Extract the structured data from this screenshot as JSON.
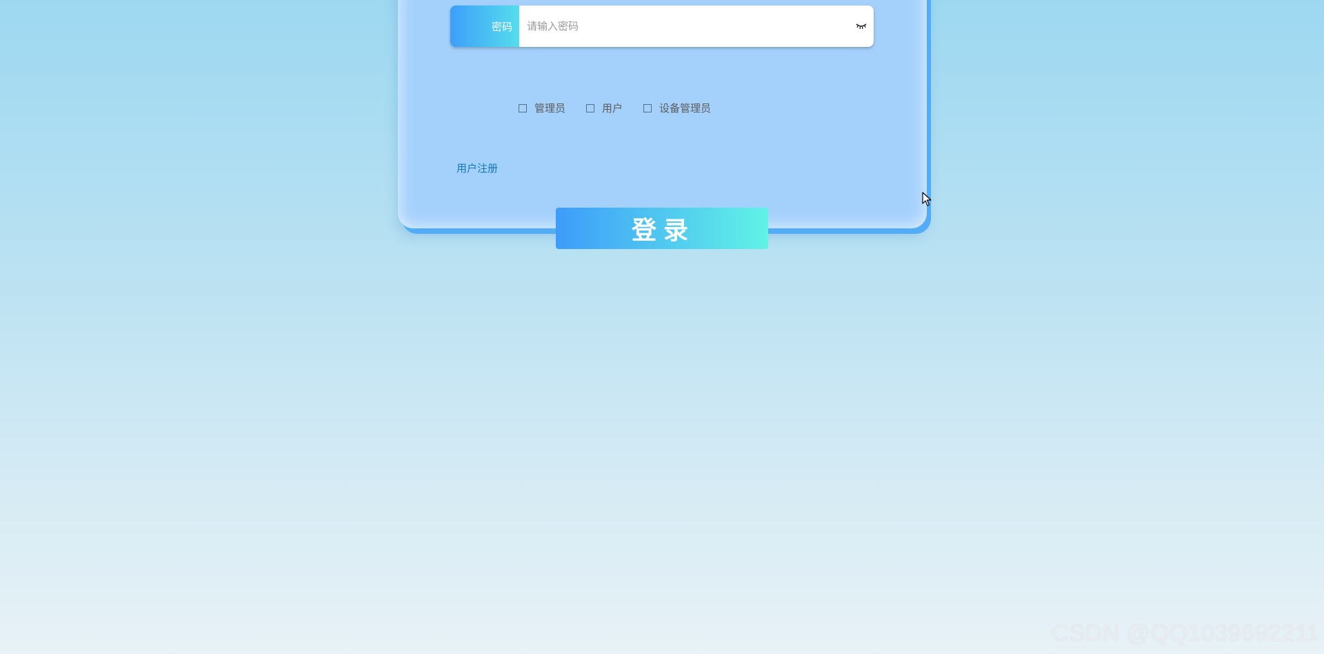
{
  "password": {
    "label": "密码",
    "placeholder": "请输入密码",
    "toggle_icon": "eye-closed-icon"
  },
  "roles": [
    {
      "label": "管理员",
      "checked": false
    },
    {
      "label": "用户",
      "checked": false
    },
    {
      "label": "设备管理员",
      "checked": false
    }
  ],
  "register_link": "用户注册",
  "login_button": "登录",
  "watermark": "CSDN @QQ1039692211",
  "colors": {
    "card": "#a4d1fc",
    "gradient_start": "#3d9ff9",
    "gradient_end": "#5ef0e8",
    "link": "#1677b8"
  }
}
